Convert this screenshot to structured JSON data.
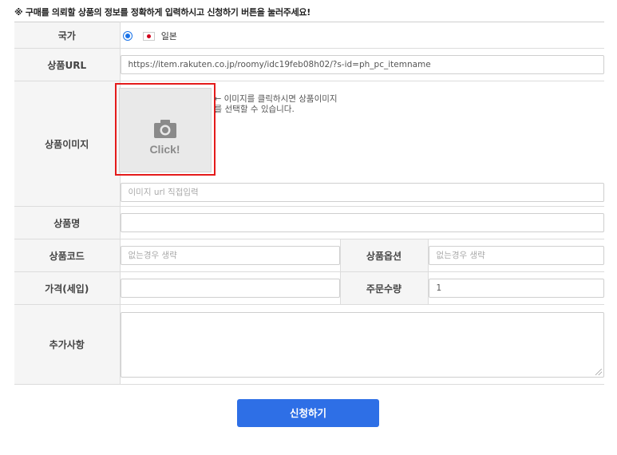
{
  "notice": "※ 구매를 의뢰할 상품의 정보를 정확하게 입력하시고 신청하기 버튼을 눌러주세요!",
  "country": {
    "label": "국가",
    "value": "일본",
    "flag_icon": "japan-flag-icon"
  },
  "product_url": {
    "label": "상품URL",
    "value": "https://item.rakuten.co.jp/roomy/idc19feb08h02/?s-id=ph_pc_itemname"
  },
  "product_image": {
    "label": "상품이미지",
    "click_text": "Click!",
    "note_line1": "← 이미지를 클릭하시면 상품이미지",
    "note_line2": "를 선택할 수 있습니다.",
    "url_placeholder": "이미지 url 직접입력",
    "icon": "camera-icon"
  },
  "product_name": {
    "label": "상품명",
    "value": ""
  },
  "product_code": {
    "label": "상품코드",
    "placeholder": "없는경우 생략"
  },
  "product_option": {
    "label": "상품옵션",
    "placeholder": "없는경우 생략"
  },
  "price": {
    "label": "가격(세입)",
    "value": ""
  },
  "quantity": {
    "label": "주문수량",
    "value": "1"
  },
  "extra": {
    "label": "추가사항",
    "value": ""
  },
  "submit_label": "신청하기",
  "colors": {
    "accent": "#2e6fe6",
    "highlight": "#e41b1b",
    "label_bg": "#f5f5f5"
  }
}
